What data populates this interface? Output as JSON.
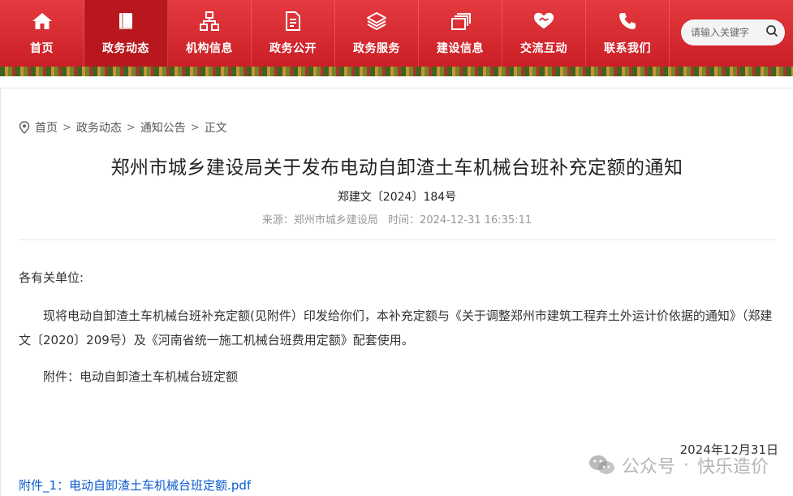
{
  "nav": {
    "items": [
      {
        "label": "首页",
        "icon": "home-icon",
        "active": false
      },
      {
        "label": "政务动态",
        "icon": "book-icon",
        "active": true
      },
      {
        "label": "机构信息",
        "icon": "org-chart-icon",
        "active": false
      },
      {
        "label": "政务公开",
        "icon": "document-icon",
        "active": false
      },
      {
        "label": "政务服务",
        "icon": "layers-icon",
        "active": false
      },
      {
        "label": "建设信息",
        "icon": "stack-icon",
        "active": false
      },
      {
        "label": "交流互动",
        "icon": "handshake-heart-icon",
        "active": false
      },
      {
        "label": "联系我们",
        "icon": "phone-icon",
        "active": false
      }
    ]
  },
  "search": {
    "placeholder": "请输入关键字"
  },
  "breadcrumb": {
    "items": [
      "首页",
      "政务动态",
      "通知公告",
      "正文"
    ],
    "separator": ">"
  },
  "article": {
    "title": "郑州市城乡建设局关于发布电动自卸渣土车机械台班补充定额的通知",
    "doc_number": "郑建文〔2024〕184号",
    "source_label": "来源：",
    "source": "郑州市城乡建设局",
    "time_label": "时间：",
    "time": "2024-12-31 16:35:11",
    "salutation": "各有关单位:",
    "paragraph": "现将电动自卸渣土车机械台班补充定额(见附件）印发给你们，本补充定额与《关于调整郑州市建筑工程弃土外运计价依据的通知》（郑建文〔2020〕209号）及《河南省统一施工机械台班费用定额》配套使用。",
    "attachment_line": "附件：电动自卸渣土车机械台班定额",
    "date": "2024年12月31日",
    "attachment_link": "附件_1：电动自卸渣土车机械台班定额.pdf"
  },
  "watermark": {
    "left": "公众号",
    "dot": "·",
    "right": "快乐造价"
  },
  "colors": {
    "nav_red": "#d51f26",
    "nav_active": "#b8171d",
    "link_blue": "#0a5ccf"
  }
}
